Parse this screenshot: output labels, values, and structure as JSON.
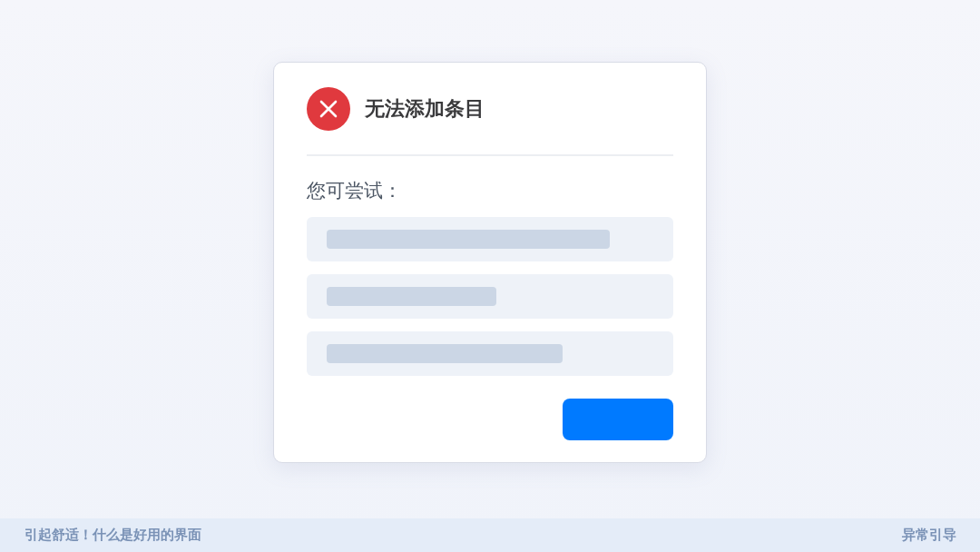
{
  "dialog": {
    "title": "无法添加条目",
    "prompt": "您可尝试：",
    "suggestions": [
      {
        "kind": "placeholder"
      },
      {
        "kind": "placeholder"
      },
      {
        "kind": "placeholder"
      }
    ]
  },
  "footer": {
    "left": "引起舒适！什么是好用的界面",
    "right": "异常引导"
  }
}
